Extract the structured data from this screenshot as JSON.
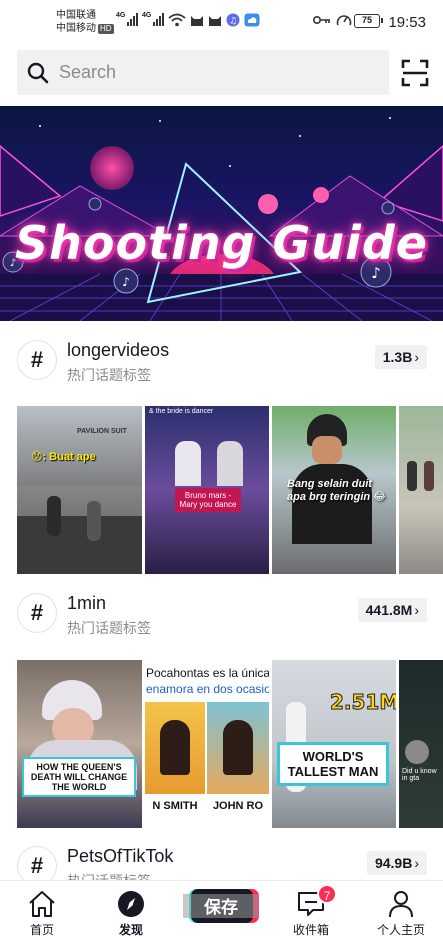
{
  "status_bar": {
    "carrier1": "中国联通",
    "carrier2": "中国移动",
    "hd": "HD",
    "net1": "4G",
    "net2": "4G",
    "battery": "75",
    "time": "19:53"
  },
  "search": {
    "placeholder": "Search"
  },
  "banner": {
    "title": "Shooting Guide"
  },
  "hashtags": [
    {
      "name": "longervideos",
      "subtitle": "热门话题标签",
      "count": "1.3B",
      "thumbs": [
        {
          "caption": "😯: Buat ape",
          "sign": "PAVILION SUIT"
        },
        {
          "caption": "& the bride is dancer",
          "overlay": "Bruno mars - Mary you dance"
        },
        {
          "caption": "Bang selain duit apa brg teringin 😂"
        },
        {
          "caption": ""
        }
      ]
    },
    {
      "name": "1min",
      "subtitle": "热门话题标签",
      "count": "441.8M",
      "thumbs": [
        {
          "caption": "HOW THE QUEEN'S DEATH WILL CHANGE THE WORLD"
        },
        {
          "caption": "Pocahontas es la única q",
          "caption2": "enamora en dos ocasion",
          "names": [
            "N SMITH",
            "JOHN RO"
          ]
        },
        {
          "caption": "WORLD'S TALLEST MAN",
          "stat": "2.51M"
        },
        {
          "caption": "Did u know in gta"
        }
      ]
    },
    {
      "name": "PetsOfTikTok",
      "subtitle": "热门话题标签",
      "count": "94.9B"
    }
  ],
  "nav": {
    "home": "首页",
    "discover": "发现",
    "save": "保存",
    "inbox": "收件箱",
    "inbox_badge": "7",
    "profile": "个人主页"
  }
}
